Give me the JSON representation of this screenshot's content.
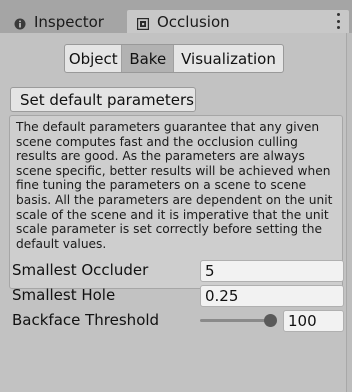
{
  "tabs": [
    {
      "label": "Inspector",
      "icon": "info-icon",
      "active": false
    },
    {
      "label": "Occlusion",
      "icon": "occlusion-icon",
      "active": true
    }
  ],
  "segments": [
    {
      "label": "Object",
      "active": false
    },
    {
      "label": "Bake",
      "active": true
    },
    {
      "label": "Visualization",
      "active": false
    }
  ],
  "set_default_label": "Set default parameters",
  "help_text": "The default parameters guarantee that any given scene computes fast and the occlusion culling results are good. As the parameters are always scene specific, better results will be achieved when fine tuning the parameters on a scene to scene basis. All the parameters are dependent on the unit scale of the scene and it is imperative that the unit scale parameter is set correctly before setting the default values.",
  "params": {
    "smallest_occluder": {
      "label": "Smallest Occluder",
      "value": "5"
    },
    "smallest_hole": {
      "label": "Smallest Hole",
      "value": "0.25"
    },
    "backface_threshold": {
      "label": "Backface Threshold",
      "value": "100",
      "slider_fraction": 1.0
    }
  },
  "colors": {
    "active_tab": "#c8c8c8",
    "tab_bar": "#a5a5a5",
    "active_segment": "#b2b2b2"
  }
}
